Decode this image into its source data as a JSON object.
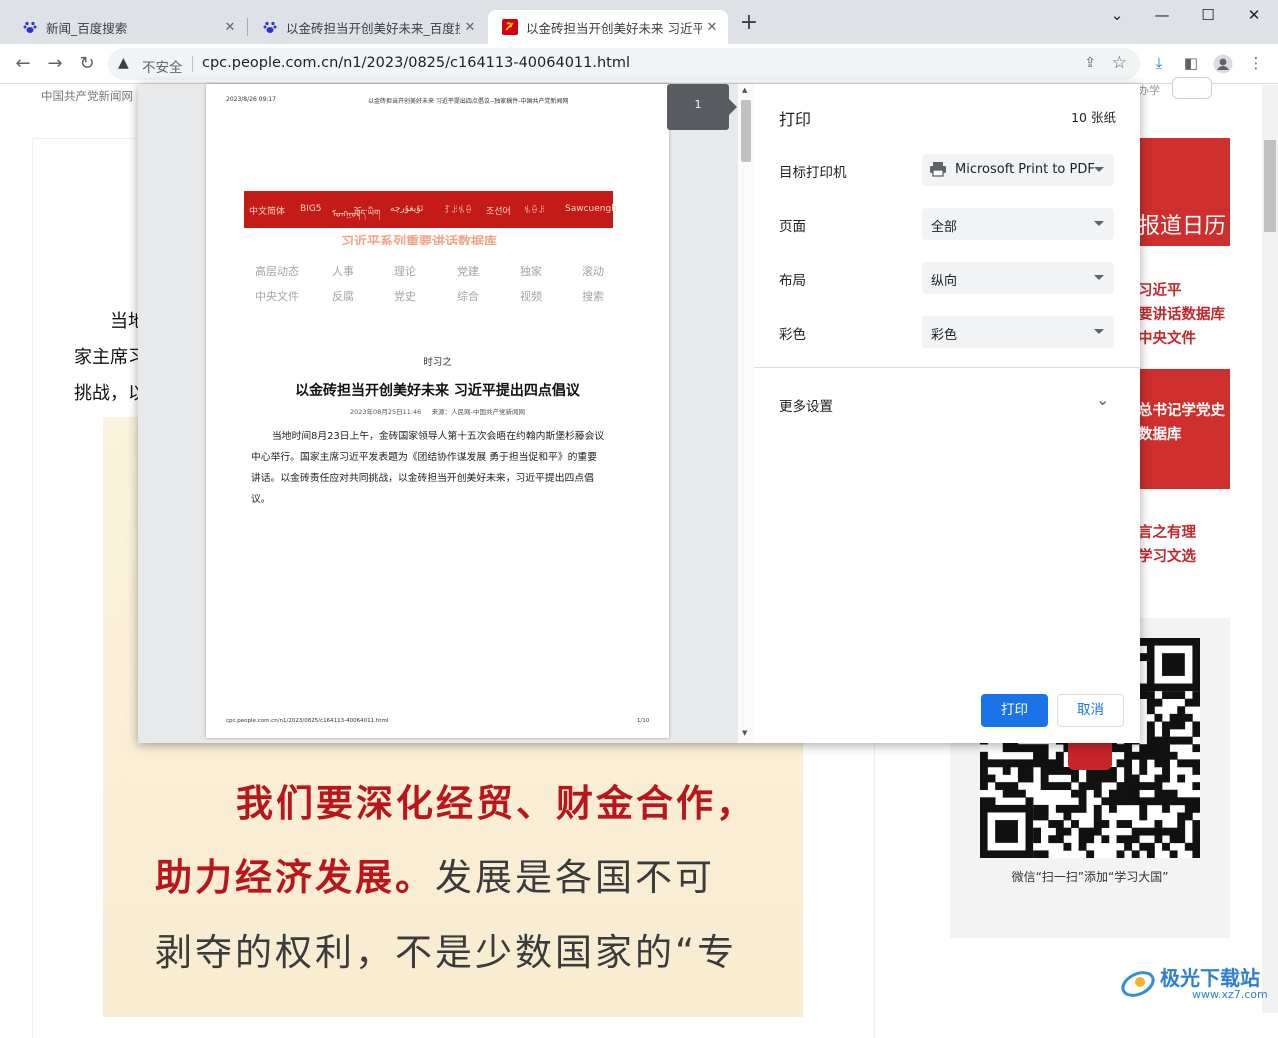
{
  "tabs": [
    {
      "title": "新闻_百度搜索",
      "icon": "baidu-paw-icon"
    },
    {
      "title": "以金砖担当开创美好未来_百度搜",
      "icon": "baidu-paw-icon"
    },
    {
      "title": "以金砖担当开创美好未来 习近平",
      "icon": "cpc-emblem-icon",
      "active": true
    }
  ],
  "window_controls": {
    "minimize": "—",
    "maximize": "☐",
    "close": "✕",
    "tab_search": "⌄"
  },
  "toolbar": {
    "security_label": "不安全",
    "url": "cpc.people.com.cn/n1/2023/0825/c164113-40064011.html"
  },
  "background_page": {
    "site_name": "中国共产党新闻网",
    "partial_text_right": "办学",
    "body_lines": [
      "当地",
      "家主席习",
      "挑战，以"
    ],
    "poster_lines": [
      {
        "parts": [
          {
            "text": "我们要深化经贸、财金合作，",
            "color": "#b8161b"
          }
        ]
      },
      {
        "parts": [
          {
            "text": "助力经济发展。",
            "color": "#b8161b"
          },
          {
            "text": "发展是各国不可",
            "color": "#3b3b3b"
          }
        ]
      },
      {
        "parts": [
          {
            "text": "剥夺的权利，不是少数国家的“专",
            "color": "#3b3b3b"
          }
        ]
      }
    ],
    "sidebar": {
      "calendar_title": "报道日历",
      "links_group1": [
        "习近平",
        "要讲话数据库",
        "中央文件"
      ],
      "block2_lines": [
        "总书记学党史",
        "数据库"
      ],
      "links_group3": [
        "言之有理",
        "学习文选"
      ],
      "qr_caption": "微信“扫一扫”添加“学习大国”"
    }
  },
  "print_preview": {
    "header_date": "2023/8/26 09:17",
    "header_title": "以金砖担当开创美好未来 习近平提出四点倡议--独家稿件-中国共产党新闻网",
    "lang_bar": [
      "中文简体",
      "BIG5",
      "ᠮᠣᠩᠭᠣᠯ",
      "ཀོད་ཡིག",
      "ئۇيغۇرچە",
      "ꆈꌠꁱꂷ",
      "조선어",
      "ꁱꂷꌠ",
      "Sawcuengh"
    ],
    "db_banner": "习近平系列重要讲话数据库",
    "nav_row1": [
      "高层动态",
      "人事",
      "理论",
      "党建",
      "独家",
      "滚动"
    ],
    "nav_row2": [
      "中央文件",
      "反腐",
      "党史",
      "综合",
      "视频",
      "搜索"
    ],
    "column": "时习之",
    "article_title": "以金砖担当开创美好未来 习近平提出四点倡议",
    "article_meta": "2023年08月25日11:46     来源：人民网-中国共产党新闻网",
    "article_body": [
      "当地时间8月23日上午，金砖国家领导人第十五次会晤在约翰内斯堡杉藤会议",
      "中心举行。国家主席习近平发表题为《团结协作谋发展 勇于担当促和平》的重要",
      "讲话。以金砖责任应对共同挑战，以金砖担当开创美好未来，习近平提出四点倡",
      "议。"
    ],
    "footer_url": "cpc.people.com.cn/n1/2023/0825/c164113-40064011.html",
    "footer_page": "1/10",
    "page_badge": "1"
  },
  "print_settings": {
    "title": "打印",
    "sheet_count": "10 张纸",
    "destination_label": "目标打印机",
    "destination_value": "Microsoft Print to PDF",
    "pages_label": "页面",
    "pages_value": "全部",
    "layout_label": "布局",
    "layout_value": "纵向",
    "color_label": "彩色",
    "color_value": "彩色",
    "more_settings": "更多设置",
    "print_button": "打印",
    "cancel_button": "取消"
  },
  "watermark": {
    "text": "极光下载站",
    "url": "www.xz7.com"
  },
  "colors": {
    "accent_blue": "#1a73e8",
    "party_red": "#cf2f2c"
  }
}
